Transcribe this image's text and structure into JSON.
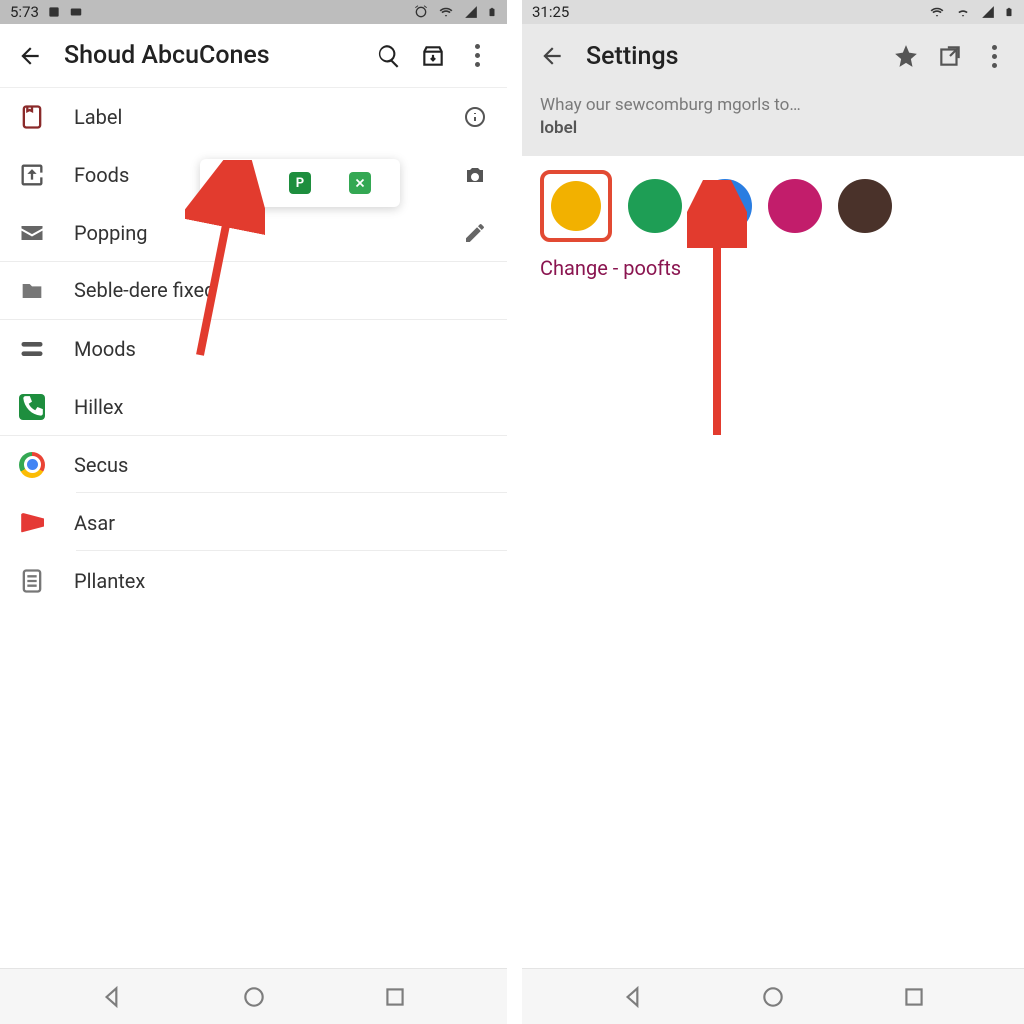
{
  "left": {
    "statusbar": {
      "time": "5:73"
    },
    "appbar": {
      "title": "Shoud AbcuCones"
    },
    "rows": [
      {
        "label": "Label"
      },
      {
        "label": "Foods"
      },
      {
        "label": "Popping"
      },
      {
        "label": "Seble-dere fixed"
      },
      {
        "label": "Moods"
      },
      {
        "label": "Hillex"
      },
      {
        "label": "Secus"
      },
      {
        "label": "Asar"
      },
      {
        "label": "Pllantex"
      }
    ]
  },
  "right": {
    "statusbar": {
      "time": "31:25"
    },
    "appbar": {
      "title": "Settings"
    },
    "subheader": {
      "line1": "Whay our sewcomburg mgorls to…",
      "line2": "lobel"
    },
    "swatches": {
      "colors": [
        "#f2b100",
        "#1e9e55",
        "#2a7de1",
        "#c21d6b",
        "#4a322a"
      ],
      "selected_index": 0
    },
    "change_label": "Change - poofts"
  }
}
